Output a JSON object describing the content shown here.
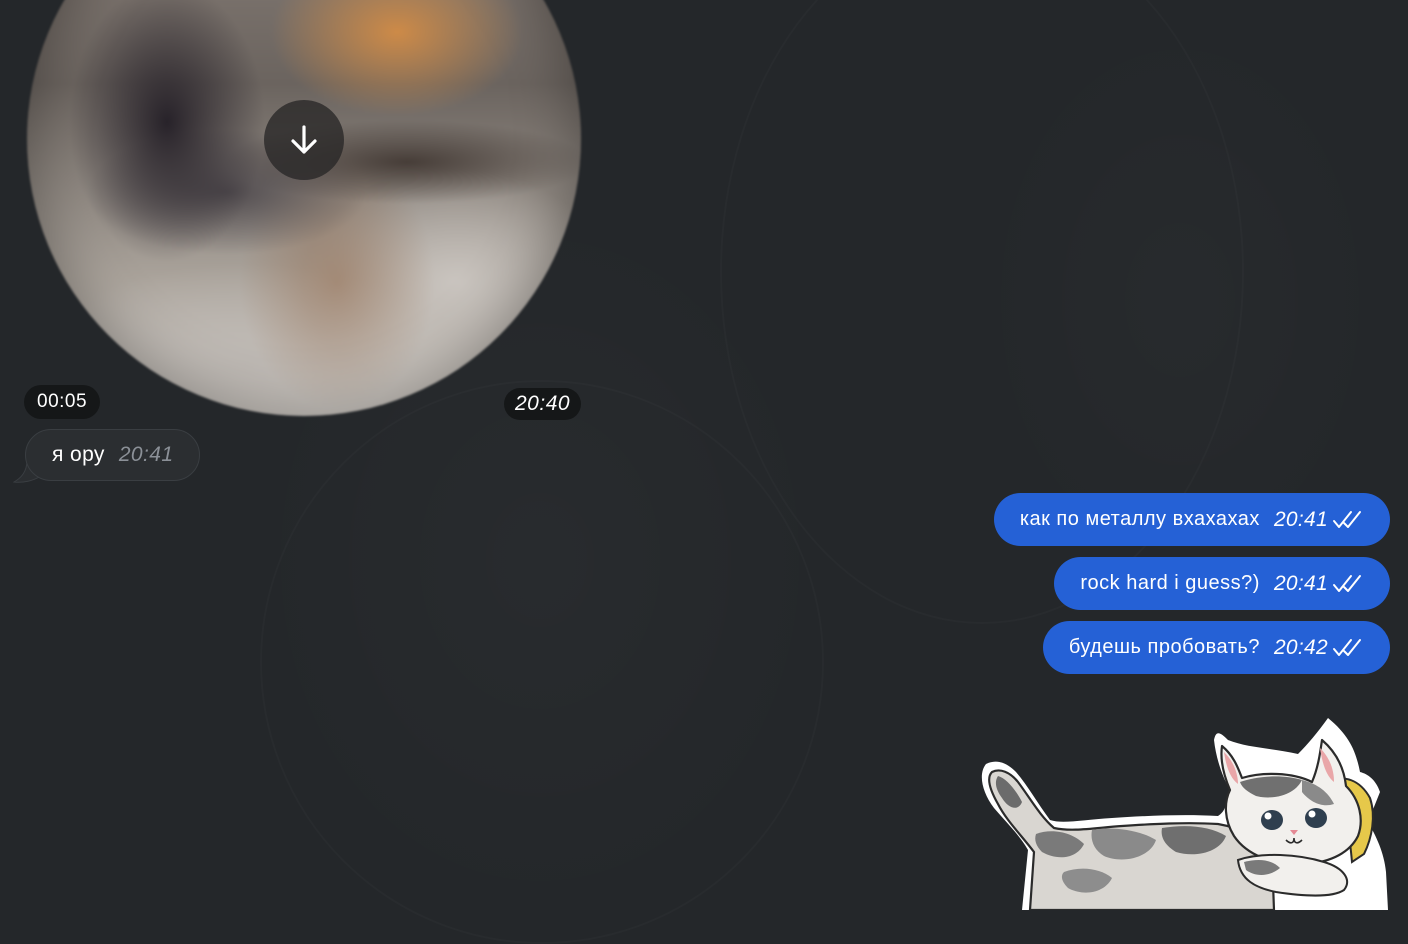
{
  "video_message": {
    "duration": "00:05",
    "time": "20:40",
    "download_icon": "arrow-down-icon"
  },
  "incoming_messages": [
    {
      "text": "я ору",
      "time": "20:41"
    }
  ],
  "outgoing_messages": [
    {
      "text": "как по металлу вхахахах",
      "time": "20:41",
      "status_icon": "double-check-icon"
    },
    {
      "text": "rock hard i guess?)",
      "time": "20:41",
      "status_icon": "double-check-icon"
    },
    {
      "text": "будешь пробовать?",
      "time": "20:42",
      "status_icon": "double-check-icon"
    }
  ],
  "sticker": {
    "icon": "cat-sticker"
  },
  "colors": {
    "background": "#24272a",
    "outgoing_bubble": "#2561d6",
    "incoming_bubble": "#2b2e31",
    "badge": "#151718"
  }
}
